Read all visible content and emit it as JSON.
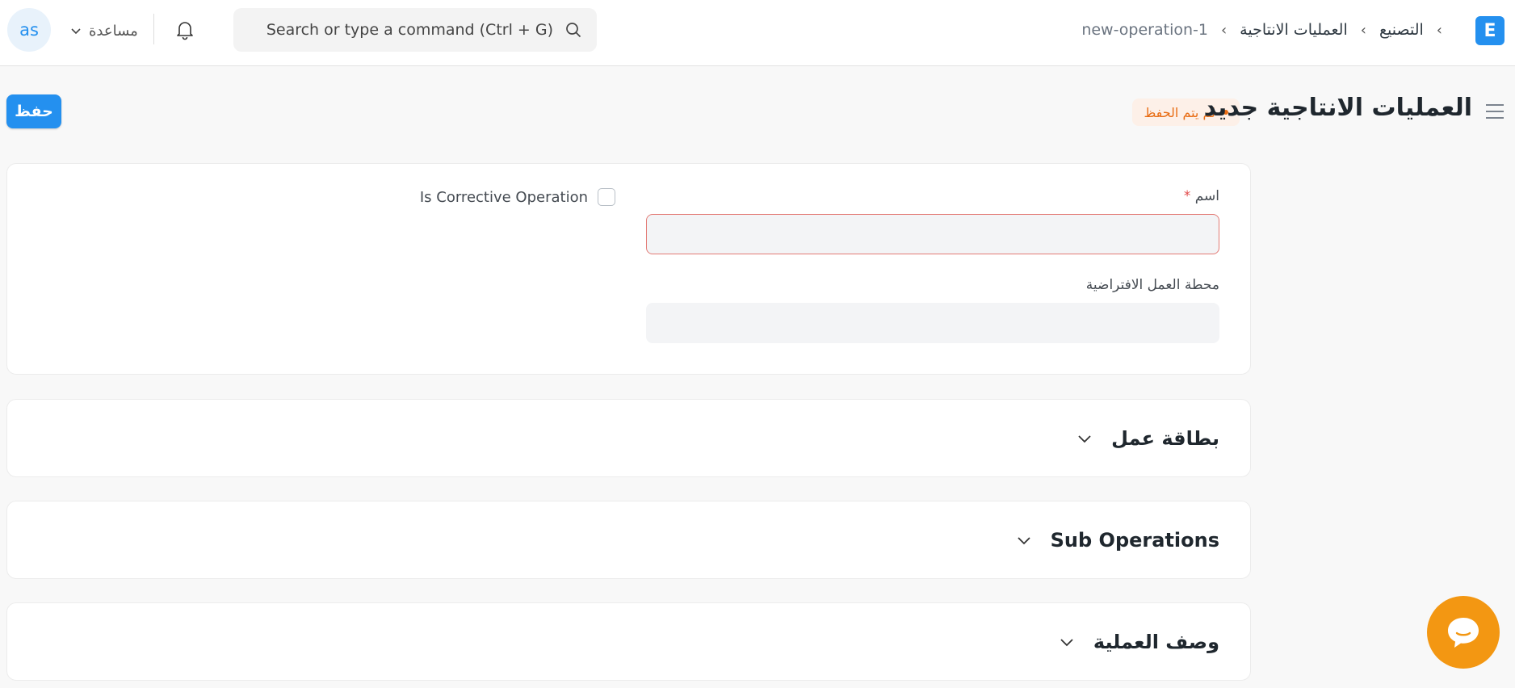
{
  "navbar": {
    "avatar_text": "as",
    "help_label": "مساعدة",
    "search_placeholder": "Search or type a command (Ctrl + G)",
    "logo_letter": "E",
    "breadcrumb": [
      "التصنيع",
      "العمليات الانتاجية",
      "new-operation-1"
    ]
  },
  "header": {
    "title": "العمليات الانتاجية جديد",
    "status": "لم يتم الحفظ",
    "save_label": "حفظ"
  },
  "form": {
    "name_label": "اسم",
    "required_mark": "*",
    "name_value": "",
    "workstation_label": "محطة العمل الافتراضية",
    "workstation_value": "",
    "corrective_label": "Is Corrective Operation"
  },
  "sections": [
    {
      "title": "بطاقة عمل"
    },
    {
      "title": "Sub Operations"
    },
    {
      "title": "وصف العملية"
    }
  ],
  "colors": {
    "accent": "#2490ef",
    "status_orange": "#e86c13",
    "chat": "#f39712"
  }
}
